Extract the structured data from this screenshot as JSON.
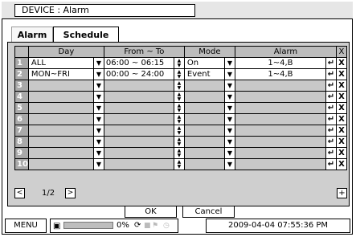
{
  "window": {
    "title": "DEVICE : Alarm"
  },
  "tabs": [
    {
      "label": "Alarm",
      "active": false
    },
    {
      "label": "Schedule",
      "active": true
    }
  ],
  "table": {
    "headers": [
      "",
      "Day",
      "From ~ To",
      "Mode",
      "Alarm",
      "X"
    ],
    "rows": [
      {
        "num": "1",
        "day": "ALL",
        "time": "06:00 ~ 06:15",
        "mode": "On",
        "alarm": "1~4,B"
      },
      {
        "num": "2",
        "day": "MON~FRI",
        "time": "00:00 ~ 24:00",
        "mode": "Event",
        "alarm": "1~4,B"
      },
      {
        "num": "3",
        "day": "",
        "time": "",
        "mode": "",
        "alarm": ""
      },
      {
        "num": "4",
        "day": "",
        "time": "",
        "mode": "",
        "alarm": ""
      },
      {
        "num": "5",
        "day": "",
        "time": "",
        "mode": "",
        "alarm": ""
      },
      {
        "num": "6",
        "day": "",
        "time": "",
        "mode": "",
        "alarm": ""
      },
      {
        "num": "7",
        "day": "",
        "time": "",
        "mode": "",
        "alarm": ""
      },
      {
        "num": "8",
        "day": "",
        "time": "",
        "mode": "",
        "alarm": ""
      },
      {
        "num": "9",
        "day": "",
        "time": "",
        "mode": "",
        "alarm": ""
      },
      {
        "num": "10",
        "day": "",
        "time": "",
        "mode": "",
        "alarm": ""
      }
    ],
    "icons": {
      "dropdown": "▼",
      "spinner": "▲▼",
      "enter": "↵",
      "delete": "X"
    }
  },
  "pagination": {
    "page_text": "1/2",
    "prev": "<",
    "next": ">",
    "add": "+"
  },
  "buttons": {
    "ok": "OK",
    "cancel": "Cancel"
  },
  "status": {
    "menu": "MENU",
    "disk_percent_label": "0%",
    "disk_usage_fraction": 0,
    "datetime": "2009-04-04  07:55:36 PM",
    "icons": [
      "disk-icon",
      "network-icon",
      "record-icon",
      "alarm-icon",
      "clock-icon"
    ]
  },
  "colors": {
    "disabled_cell": "#c8c8c8",
    "header": "#bcbcbc",
    "row_number": "#a9a9a9"
  }
}
